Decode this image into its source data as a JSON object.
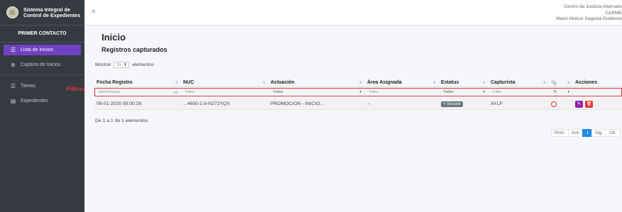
{
  "brand": {
    "logo_glyph": "⚖",
    "line1": "Sistema Integral de",
    "line2": "Control de Expedientes"
  },
  "sidebar": {
    "section": "PRIMER CONTACTO",
    "items": [
      {
        "label": "Lista de inicios",
        "icon": "list-icon",
        "glyph": "☰",
        "active": true
      },
      {
        "label": "Captura de Inicios",
        "icon": "plus-circle-icon",
        "glyph": "⊕",
        "active": false
      },
      {
        "label": "Tareas",
        "icon": "task-list-icon",
        "glyph": "☰",
        "active": false
      },
      {
        "label": "Expedientes",
        "icon": "folder-icon",
        "glyph": "▤",
        "active": false
      }
    ]
  },
  "header": {
    "menu_glyph": "≡",
    "org_line1": "Centro de Justicia Alternativ",
    "org_line2": "CARME",
    "user_name": "Mario Alonso Segovia Gutiérrez"
  },
  "main": {
    "title": "Inicio",
    "subtitle": "Registros capturados",
    "show_prefix": "Mostrar",
    "show_value": "10",
    "show_suffix": "elementos",
    "columns": [
      "Fecha Registro",
      "NUC",
      "Actuación",
      "Área Asignada",
      "Estatus",
      "Capturista",
      "📎",
      "Acciones"
    ],
    "filters": {
      "fecha_placeholder": "dd/mm/aaaa",
      "nuc_placeholder": "Filtro",
      "actuacion_value": "Todos",
      "area_placeholder": "Filtro",
      "estatus_value": "Todos",
      "capturista_placeholder": "Filtro",
      "clip_value": "Tc"
    },
    "filters_annotation": "Filtros",
    "rows": [
      {
        "fecha": "09-01-2025 09:00:26",
        "nuc": "...4600-1-9-N272YQX",
        "actuacion": "PROMOCION - INICIO...",
        "area": "--",
        "estatus": "Borrador",
        "capturista": "AYLP"
      }
    ],
    "info": "De 1 a 1 de 1 elementos",
    "pagination": [
      "Prim.",
      "Ant.",
      "1",
      "Sig.",
      "Últ."
    ]
  },
  "colors": {
    "sidebar_bg": "#343a40",
    "active_item": "#6f42c1",
    "filter_border": "#e53935",
    "page_active": "#1e88e5",
    "edit_button": "#8e24aa",
    "delete_button": "#e53935"
  }
}
